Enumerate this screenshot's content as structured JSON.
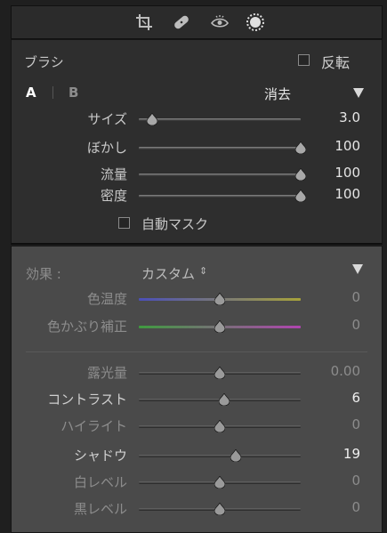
{
  "toolstrip": {
    "tools": [
      {
        "icon": "crop-icon"
      },
      {
        "icon": "bandage-icon"
      },
      {
        "icon": "redeye-icon"
      },
      {
        "icon": "radial-brush-icon"
      }
    ]
  },
  "brush": {
    "title": "ブラシ",
    "invert_label": "反転",
    "invert_checked": false,
    "tab_a": "A",
    "tab_b": "B",
    "erase_label": "消去",
    "sliders": [
      {
        "label": "サイズ",
        "value": "3.0",
        "level": 0.08
      },
      {
        "label": "ぼかし",
        "value": "100",
        "level": 1.0
      },
      {
        "label": "流量",
        "value": "100",
        "level": 1.0
      },
      {
        "label": "密度",
        "value": "100",
        "level": 1.0
      }
    ],
    "automask_label": "自動マスク",
    "automask_checked": false
  },
  "effect": {
    "label": "効果 :",
    "preset": "カスタム",
    "color_sliders": [
      {
        "label": "色温度",
        "value": "0",
        "level": 0.5,
        "track": "temp"
      },
      {
        "label": "色かぶり補正",
        "value": "0",
        "level": 0.5,
        "track": "tint"
      }
    ],
    "tone_sliders": [
      {
        "label": "露光量",
        "value": "0.00",
        "level": 0.5,
        "active": false
      },
      {
        "label": "コントラスト",
        "value": "6",
        "level": 0.53,
        "active": true
      },
      {
        "label": "ハイライト",
        "value": "0",
        "level": 0.5,
        "active": false
      },
      {
        "label": "シャドウ",
        "value": "19",
        "level": 0.6,
        "active": true
      },
      {
        "label": "白レベル",
        "value": "0",
        "level": 0.5,
        "active": false
      },
      {
        "label": "黒レベル",
        "value": "0",
        "level": 0.5,
        "active": false
      }
    ]
  },
  "colors": {
    "panel_text": "#c8c8c8",
    "dim_text": "#8c8c8c",
    "value_text": "#e6e6e6",
    "temp_gradient": [
      "#4b4fb8",
      "#a7a23a"
    ],
    "tint_gradient": [
      "#3f9b3f",
      "#b044b0"
    ]
  }
}
